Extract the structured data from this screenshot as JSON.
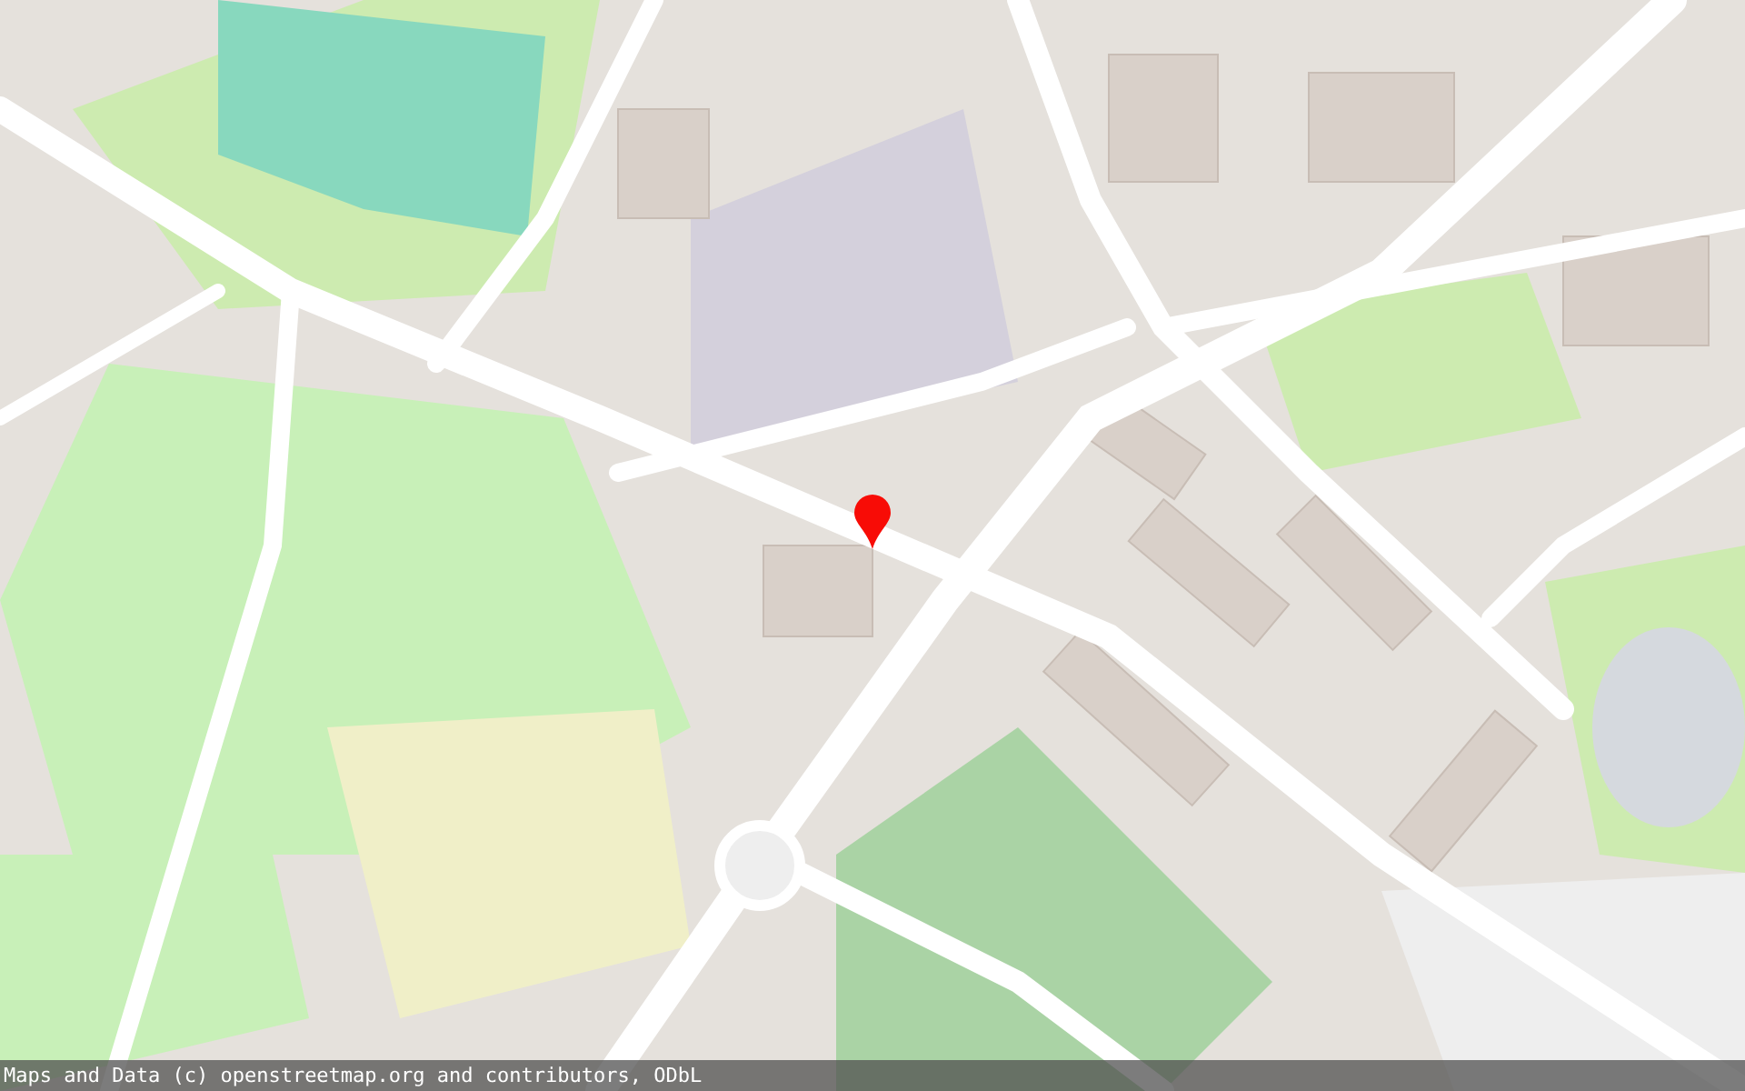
{
  "attribution": "Maps and Data (c) openstreetmap.org and contributors, ODbL"
}
